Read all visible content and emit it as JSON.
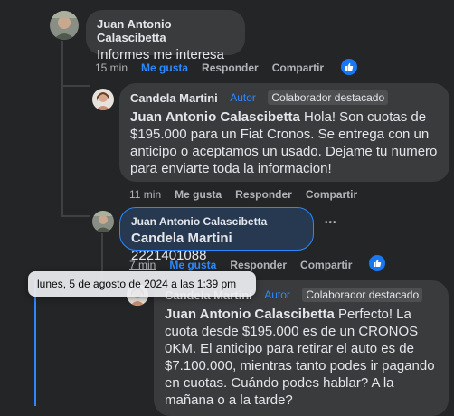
{
  "comments": [
    {
      "author": "Juan Antonio Calascibetta",
      "text": "Informes me interesa",
      "time": "15 min",
      "like": "Me gusta",
      "reply": "Responder",
      "share": "Compartir"
    },
    {
      "author": "Candela Martini",
      "badge_author": "Autor",
      "badge_contributor": "Colaborador destacado",
      "mention": "Juan Antonio Calascibetta",
      "text": " Hola! Son cuotas de $195.000 para un Fiat Cronos. Se entrega con un anticipo o aceptamos un usado. Dejame tu numero para enviarte toda la informacion!",
      "time": "11 min",
      "like": "Me gusta",
      "reply": "Responder",
      "share": "Compartir"
    },
    {
      "author": "Juan Antonio Calascibetta",
      "mention": "Candela Martini",
      "text": " 2221401088",
      "time": "7 min",
      "like": "Me gusta",
      "reply": "Responder",
      "share": "Compartir",
      "more": "•••"
    },
    {
      "author": "Candela Martini",
      "badge_author": "Autor",
      "badge_contributor": "Colaborador destacado",
      "mention": "Juan Antonio Calascibetta",
      "text": " Perfecto! La cuota desde $195.000 es de un CRONOS 0KM. El anticipo para retirar el auto es de $7.100.000, mientras tanto podes ir pagando en cuotas. Cuándo podes hablar? A la mañana o a la tarde?"
    }
  ],
  "tooltip": "lunes, 5 de agosto de 2024 a las 1:39 pm",
  "colors": {
    "background": "#242526",
    "bubble": "#3a3b3c",
    "accent": "#2d88ff"
  }
}
